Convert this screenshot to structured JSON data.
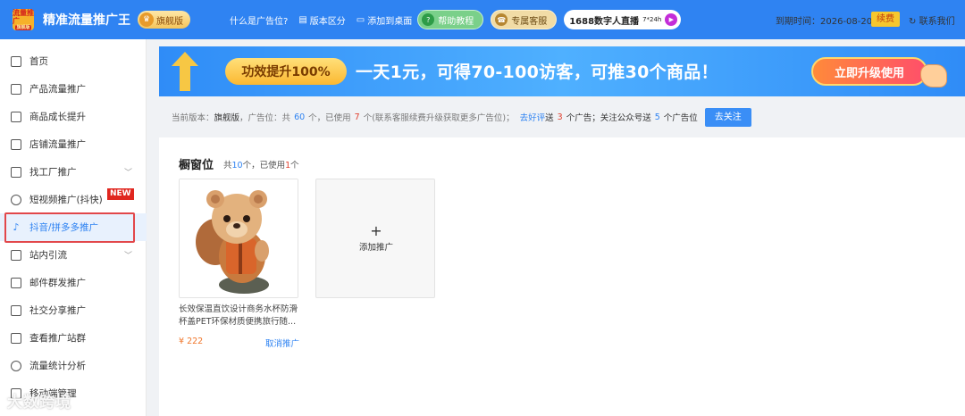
{
  "header": {
    "logo_text": "流量推广",
    "logo_sub": "旗舰版",
    "app_title": "精准流量推广王",
    "edition": "旗舰版",
    "links": [
      "什么是广告位?",
      "版本区分",
      "添加到桌面"
    ],
    "help_btn": "帮助教程",
    "service_btn": "专属客服",
    "live_btn": "1688数字人直播",
    "live_tag": "7*24h",
    "expire": "到期时间：2026-08-20",
    "renew": "续费",
    "contact": "联系我们"
  },
  "sidebar": {
    "items": [
      {
        "label": "首页",
        "icon": "home-icon",
        "chevron": false
      },
      {
        "label": "产品流量推广",
        "icon": "bag-icon",
        "chevron": false
      },
      {
        "label": "商品成长提升",
        "icon": "growth-icon",
        "chevron": false
      },
      {
        "label": "店铺流量推广",
        "icon": "store-icon",
        "chevron": false
      },
      {
        "label": "找工厂推广",
        "icon": "factory-icon",
        "chevron": true
      },
      {
        "label": "短视频推广(抖快)",
        "icon": "video-icon",
        "chevron": false
      },
      {
        "label": "抖音/拼多多推广",
        "icon": "tiktok-icon",
        "chevron": false
      },
      {
        "label": "站内引流",
        "icon": "inner-flow-icon",
        "chevron": true
      },
      {
        "label": "邮件群发推广",
        "icon": "mail-icon",
        "chevron": false
      },
      {
        "label": "社交分享推广",
        "icon": "share-icon",
        "chevron": false
      },
      {
        "label": "查看推广站群",
        "icon": "megaphone-icon",
        "chevron": false
      },
      {
        "label": "流量统计分析",
        "icon": "stats-icon",
        "chevron": false
      },
      {
        "label": "移动端管理",
        "icon": "mobile-icon",
        "chevron": false
      }
    ],
    "new_badge": "NEW"
  },
  "banner": {
    "chip": "功效提升100%",
    "text": "一天1元，可得70-100访客，可推30个商品！",
    "button": "立即升级使用"
  },
  "info": {
    "version_label": "当前版本：",
    "version": "旗舰版",
    "slots_label": "，广告位：",
    "total_prefix": "共",
    "total": "60",
    "used_prefix": "个，已使用",
    "used": "7",
    "used_suffix": "个(联系客服续费升级获取更多广告位)；",
    "review_link": "去好评",
    "review_prefix": "送",
    "review_count": "3",
    "review_suffix": "个广告；关注公众号送",
    "follow_count": "5",
    "follow_suffix": "个广告位",
    "follow_btn": "去关注"
  },
  "panel": {
    "title": "橱窗位",
    "count_prefix": "共",
    "total": "10",
    "used_prefix": "个，已使用",
    "used": "1",
    "used_suffix": "个",
    "product": {
      "name": "长效保温直饮设计商务水杯防滑杯盖PET环保材质便携旅行随...",
      "price": "¥ 222",
      "cancel": "取消推广"
    },
    "add_label": "添加推广"
  },
  "watermark": "大数跨境",
  "colors": {
    "primary": "#2f83f2",
    "highlight": "#e2474a",
    "price": "#f0762b"
  }
}
